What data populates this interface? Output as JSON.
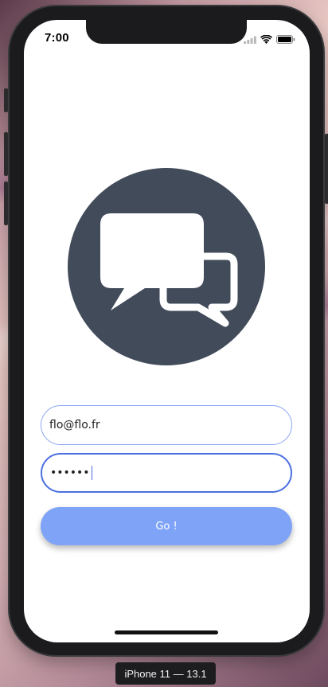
{
  "status_bar": {
    "time": "7:00",
    "icons": [
      "signal-icon",
      "wifi-icon",
      "battery-icon"
    ]
  },
  "logo": {
    "icon": "chat-bubbles-icon",
    "circle_color": "#424b5a",
    "bubble_color": "#ffffff"
  },
  "form": {
    "email_value": "flo@flo.fr",
    "password_value": "••••••",
    "submit_label": "Go !"
  },
  "colors": {
    "button": "#7fa3f7",
    "focus_border": "#4a6fe0",
    "input_border": "#8ca7f5"
  },
  "device_label": "iPhone 11 — 13.1"
}
